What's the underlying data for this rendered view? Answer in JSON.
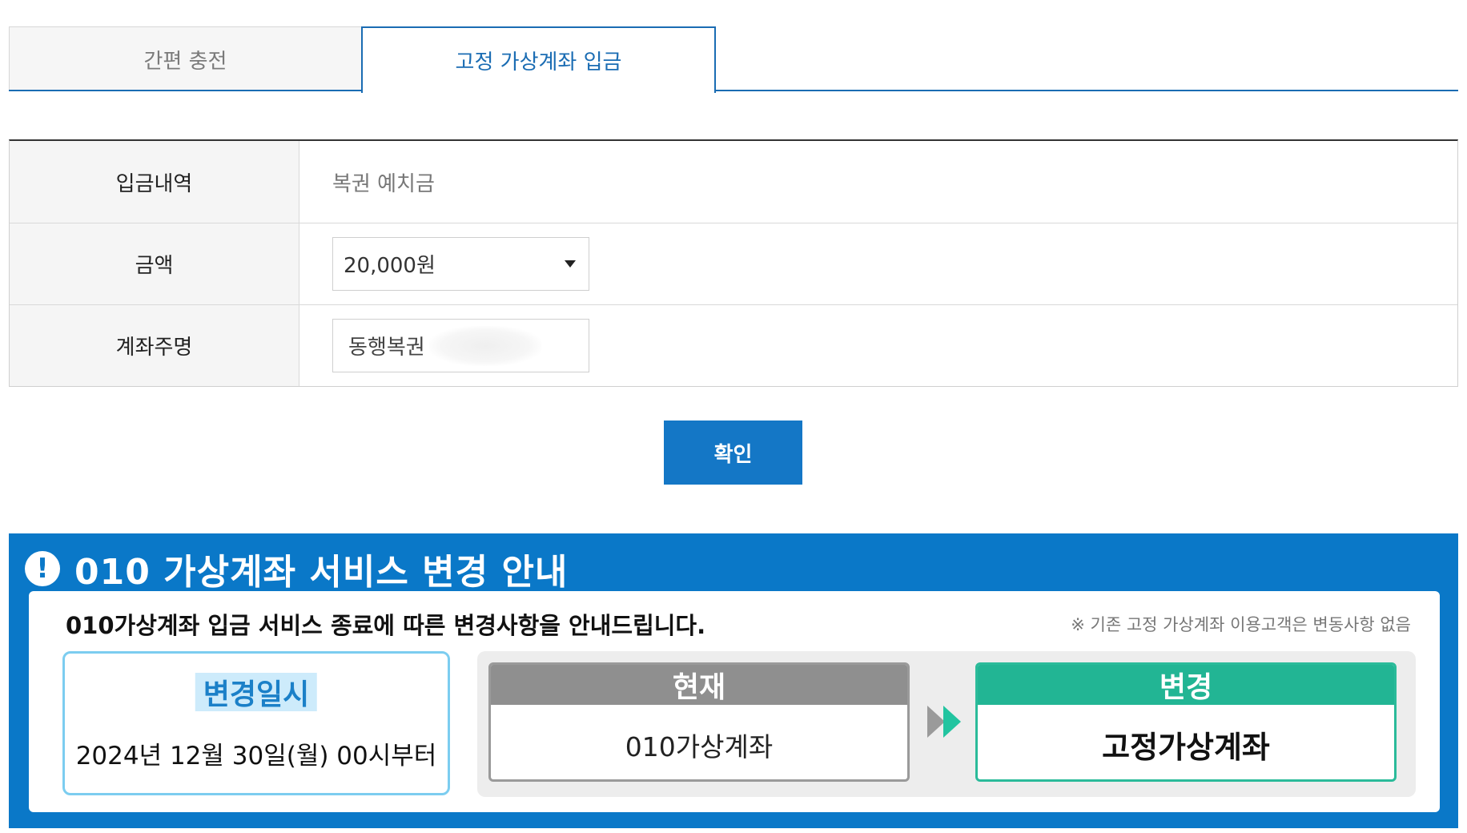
{
  "tabs": [
    {
      "label": "간편 충전",
      "active": false
    },
    {
      "label": "고정 가상계좌 입금",
      "active": true
    }
  ],
  "form": {
    "rows": [
      {
        "label": "입금내역",
        "value": "복권 예치금"
      },
      {
        "label": "금액",
        "selected": "20,000원"
      },
      {
        "label": "계좌주명",
        "value": "동행복권"
      }
    ]
  },
  "confirm_label": "확인",
  "notice": {
    "title": "010 가상계좌 서비스 변경 안내",
    "main_text": "010가상계좌 입금 서비스 종료에 따른 변경사항을 안내드립니다.",
    "note": "※ 기존 고정 가상계좌 이용고객은 변동사항 없음",
    "date_label": "변경일시",
    "date_value": "2024년 12월 30일(월) 00시부터",
    "current_label": "현재",
    "current_value": "010가상계좌",
    "new_label": "변경",
    "new_value": "고정가상계좌"
  },
  "colors": {
    "primary": "#1477c6",
    "banner": "#0a78c8",
    "green": "#22b594",
    "gray": "#8f8f8f",
    "sky": "#7ccdf0"
  }
}
